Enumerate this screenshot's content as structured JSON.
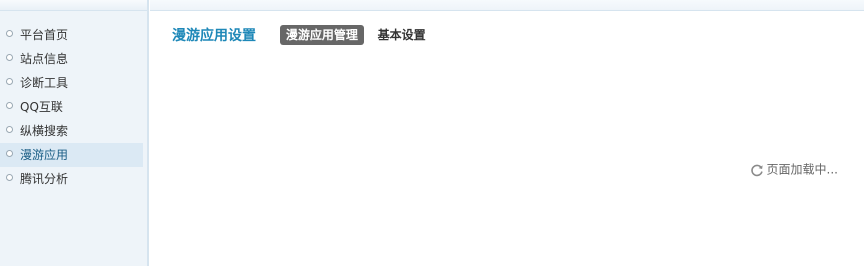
{
  "sidebar": {
    "items": [
      {
        "label": "平台首页",
        "active": false
      },
      {
        "label": "站点信息",
        "active": false
      },
      {
        "label": "诊断工具",
        "active": false
      },
      {
        "label": "QQ互联",
        "active": false
      },
      {
        "label": "纵横搜索",
        "active": false
      },
      {
        "label": "漫游应用",
        "active": true
      },
      {
        "label": "腾讯分析",
        "active": false
      }
    ]
  },
  "header": {
    "title": "漫游应用设置",
    "tabs": [
      {
        "label": "漫游应用管理",
        "active": true
      },
      {
        "label": "基本设置",
        "active": false
      }
    ]
  },
  "main": {
    "loading_text": "页面加载中..."
  },
  "colors": {
    "title": "#1e88b8",
    "active_tab_bg": "#676767",
    "sidebar_bg": "#eef4f9",
    "sidebar_active_bg": "#dbe9f4"
  }
}
